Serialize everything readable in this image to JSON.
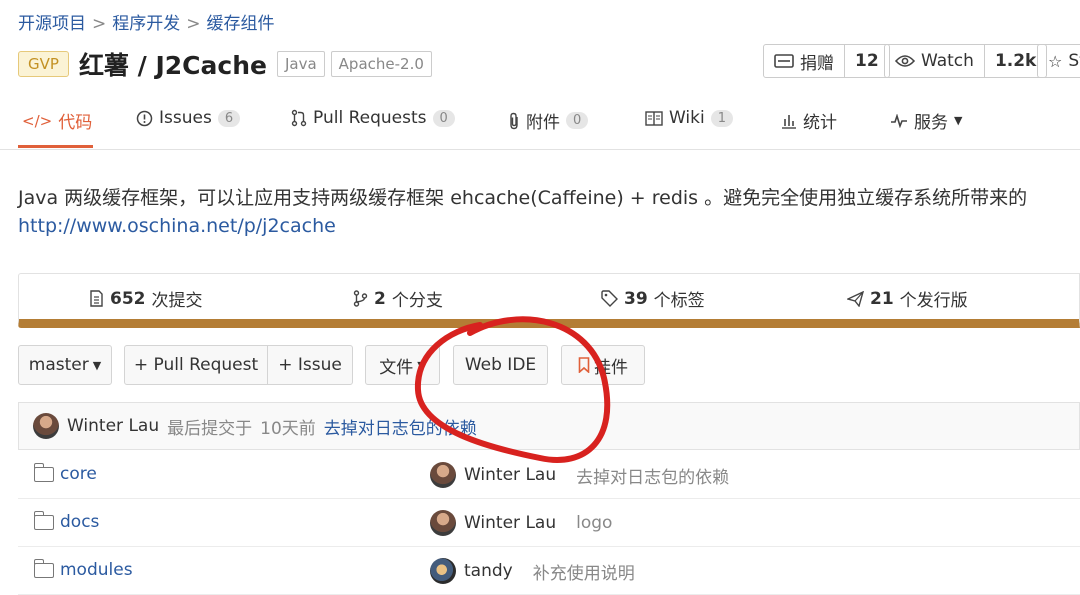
{
  "breadcrumb": {
    "items": [
      "开源项目",
      "程序开发",
      "缓存组件"
    ],
    "separator": ">"
  },
  "repo": {
    "gvp_badge": "GVP",
    "title": "红薯 / J2Cache",
    "language_tag": "Java",
    "license_tag": "Apache-2.0"
  },
  "social": {
    "donate_label": "捐赠",
    "donate_count": "12",
    "watch_label": "Watch",
    "watch_count": "1.2k",
    "star_label": "St"
  },
  "tabs": [
    {
      "label": "代码",
      "badge": ""
    },
    {
      "label": "Issues",
      "badge": "6"
    },
    {
      "label": "Pull Requests",
      "badge": "0"
    },
    {
      "label": "附件",
      "badge": "0"
    },
    {
      "label": "Wiki",
      "badge": "1"
    },
    {
      "label": "统计",
      "badge": ""
    },
    {
      "label": "服务",
      "badge": ""
    }
  ],
  "description": "Java 两级缓存框架，可以让应用支持两级缓存框架 ehcache(Caffeine) + redis 。避免完全使用独立缓存系统所带来的",
  "homepage": "http://www.oschina.net/p/j2cache",
  "stats": {
    "commits_count": "652",
    "commits_label": "次提交",
    "branches_count": "2",
    "branches_label": "个分支",
    "tags_count": "39",
    "tags_label": "个标签",
    "releases_count": "21",
    "releases_label": "个发行版"
  },
  "toolbar": {
    "branch": "master",
    "pull_request": "+ Pull Request",
    "issue": "+ Issue",
    "file": "文件",
    "web_ide": "Web IDE",
    "widget": "挂件"
  },
  "last_commit": {
    "author": "Winter Lau",
    "prefix": "最后提交于",
    "time": "10天前",
    "message": "去掉对日志包的依赖"
  },
  "files": [
    {
      "name": "core",
      "author": "Winter Lau",
      "message": "去掉对日志包的依赖"
    },
    {
      "name": "docs",
      "author": "Winter Lau",
      "message": "logo"
    },
    {
      "name": "modules",
      "author": "tandy",
      "message": "补充使用说明"
    }
  ],
  "colors": {
    "accent": "#e0603a",
    "link": "#2b5aa0",
    "stats_bar": "#b47d35",
    "annotation": "#d8221f"
  }
}
